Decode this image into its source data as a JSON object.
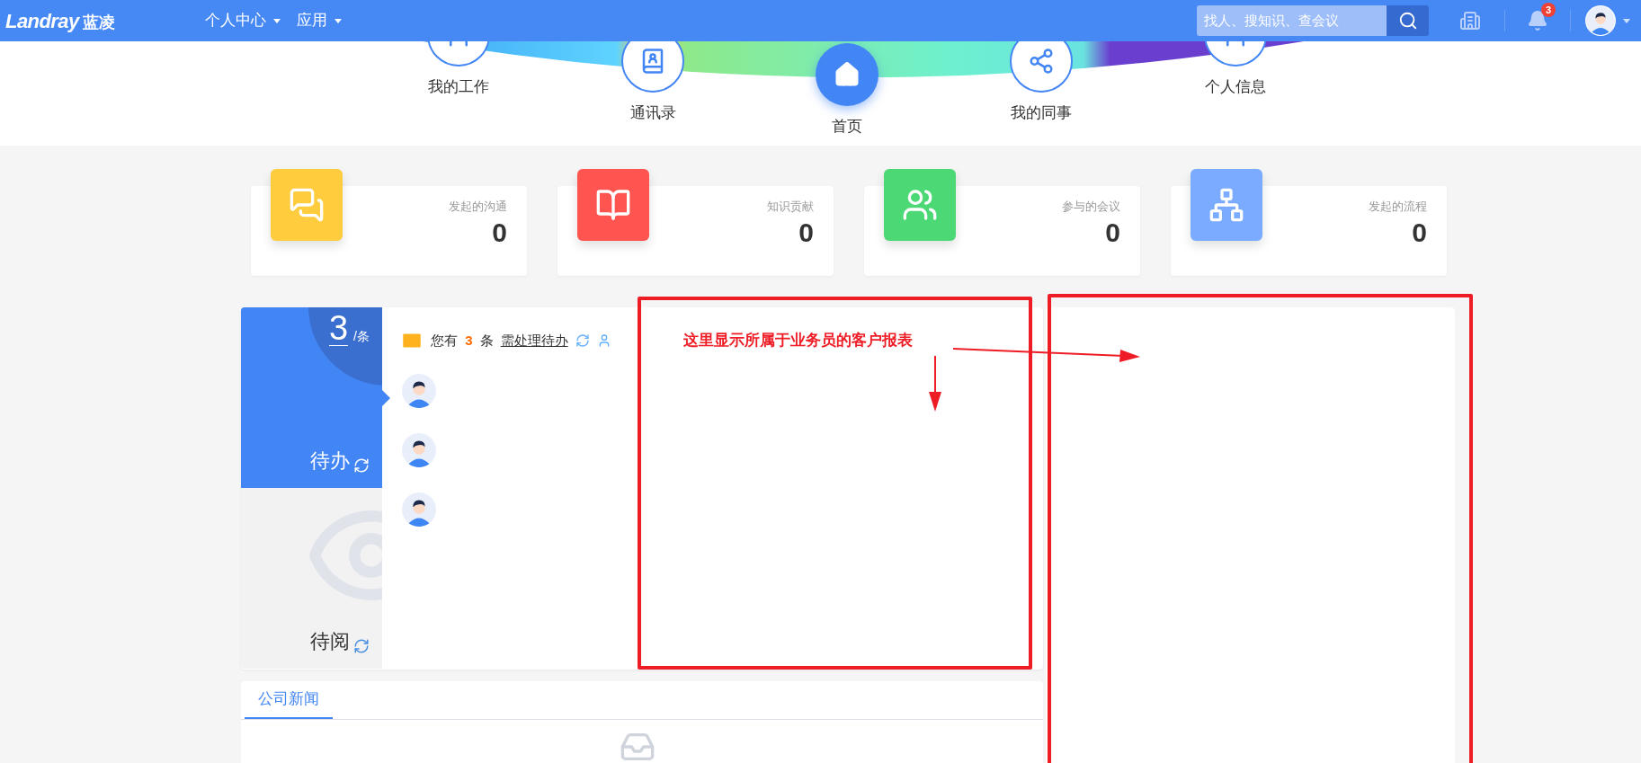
{
  "header": {
    "logo": "Landray",
    "logo_cn": "蓝凌",
    "menus": [
      {
        "label": "个人中心"
      },
      {
        "label": "应用"
      }
    ],
    "search": {
      "placeholder": "找人、搜知识、查会议"
    },
    "notification_count": "3"
  },
  "quick_nav": [
    {
      "label": "我的工作",
      "kind": "work",
      "selected": false
    },
    {
      "label": "通讯录",
      "kind": "contacts",
      "selected": false
    },
    {
      "label": "首页",
      "kind": "home",
      "selected": true
    },
    {
      "label": "我的同事",
      "kind": "colleagues",
      "selected": false
    },
    {
      "label": "个人信息",
      "kind": "profile",
      "selected": false
    }
  ],
  "stats": [
    {
      "label": "发起的沟通",
      "value": "0",
      "color": "#ffcc3d",
      "kind": "chat"
    },
    {
      "label": "知识贡献",
      "value": "0",
      "color": "#ff5551",
      "kind": "book"
    },
    {
      "label": "参与的会议",
      "value": "0",
      "color": "#4cd874",
      "kind": "meeting"
    },
    {
      "label": "发起的流程",
      "value": "0",
      "color": "#7aabff",
      "kind": "flow"
    }
  ],
  "todo": {
    "tabs": [
      {
        "label": "待办",
        "count": "3",
        "unit": "/条",
        "selected": true
      },
      {
        "label": "待阅",
        "selected": false
      }
    ],
    "summary": {
      "prefix": "您有",
      "count": "3",
      "suffix": "条",
      "link": "需处理待办"
    },
    "items": [
      {
        "kind": "avatar"
      },
      {
        "kind": "avatar"
      },
      {
        "kind": "avatar"
      }
    ]
  },
  "news": {
    "tabs": [
      {
        "label": "公司新闻",
        "selected": true
      }
    ]
  },
  "annotation": {
    "text": "这里显示所属于业务员的客户报表"
  }
}
